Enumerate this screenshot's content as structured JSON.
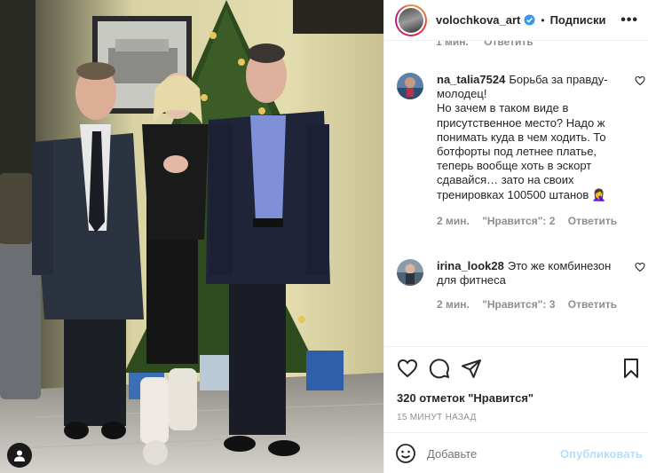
{
  "header": {
    "username": "volochkova_art",
    "separator": "•",
    "follow_label": "Подписки",
    "more_label": "•••"
  },
  "previous_comment_meta": {
    "time": "1 мин.",
    "reply_label": "Ответить"
  },
  "comments": [
    {
      "username": "na_talia7524",
      "text": "Борьба за правду- молодец!\nНо зачем в таком виде в присутственное место? Надо ж понимать куда в чем ходить. То ботфорты под летнее платье, теперь вообще хоть в эскорт сдавайся… зато на своих тренировках 100500 штанов 🤦‍♀️",
      "time": "2 мин.",
      "likes_label": "\"Нравится\": 2",
      "reply_label": "Ответить"
    },
    {
      "username": "irina_look28",
      "text": "Это же комбинезон для фитнеса",
      "time": "2 мин.",
      "likes_label": "\"Нравится\": 3",
      "reply_label": "Ответить"
    }
  ],
  "post": {
    "likes_text": "320 отметок \"Нравится\"",
    "posted_ago": "15 МИНУТ НАЗАД"
  },
  "add_comment": {
    "placeholder": "Добавьте",
    "publish_label": "Опубликовать"
  },
  "colors": {
    "verified": "#3897f0",
    "publish_disabled": "#b2dffc",
    "meta_gray": "#8e8e8e"
  },
  "icons": [
    "verified-icon",
    "more-icon",
    "heart-icon",
    "comment-icon",
    "share-icon",
    "bookmark-icon",
    "emoji-icon",
    "user-tag-icon"
  ]
}
